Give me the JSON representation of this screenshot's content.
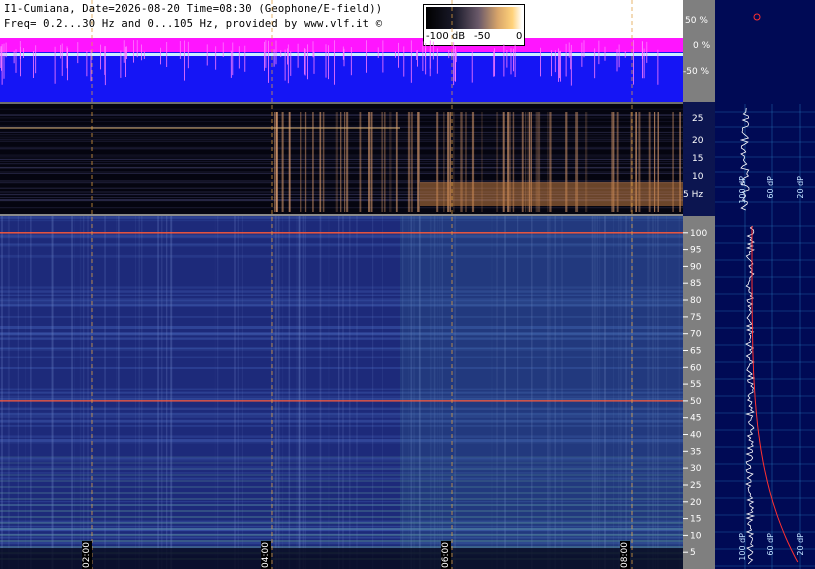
{
  "header": {
    "line1": "I1-Cumiana, Date=2026-08-20 Time=08:30 (Geophone/E-field))",
    "line2": "Freq= 0.2...30 Hz and 0...105 Hz, provided by www.vlf.it ©"
  },
  "colorbar": {
    "labels": [
      "-100 dB",
      "-50",
      "0"
    ]
  },
  "chart_data": [
    {
      "type": "line",
      "panel": "amplitude",
      "y_ticks": [
        "50 %",
        "0 %",
        "-50 %"
      ],
      "colors": {
        "envelope": "#ff15ff",
        "trace": "#1515f5",
        "baseline": "#c9f0ff"
      }
    },
    {
      "type": "heatmap",
      "panel": "spectrogram-low",
      "y_ticks": [
        "25",
        "20",
        "15",
        "10",
        "5 Hz"
      ],
      "ylim": [
        0.2,
        30
      ]
    },
    {
      "type": "heatmap",
      "panel": "spectrogram-high",
      "y_ticks": [
        "100",
        "95",
        "90",
        "85",
        "80",
        "75",
        "70",
        "65",
        "60",
        "55",
        "50",
        "45",
        "40",
        "35",
        "30",
        "25",
        "20",
        "15",
        "10",
        "5"
      ],
      "ylim": [
        0,
        105
      ],
      "highlight_lines_hz": [
        100,
        50
      ]
    }
  ],
  "time_axis": {
    "labels": [
      "02:00",
      "04:00",
      "06:00",
      "08:00"
    ]
  },
  "sidebar": {
    "dp_labels_top": [
      "100 dP",
      "60 dP",
      "20 dP"
    ],
    "dp_labels_bottom": [
      "100 dP",
      "60 dP",
      "20 dP"
    ]
  }
}
